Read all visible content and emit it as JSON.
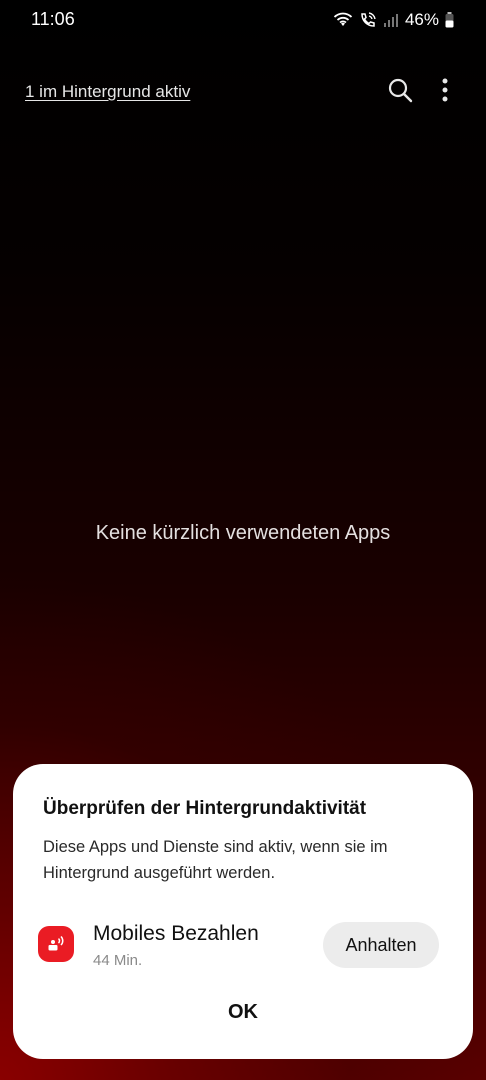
{
  "status_bar": {
    "time": "11:06",
    "battery_percent": "46%",
    "icons": [
      "wifi-icon",
      "wifi-call-icon",
      "signal-icon",
      "battery-icon"
    ]
  },
  "top": {
    "background_active_link": "1 im Hintergrund aktiv",
    "icons": [
      "search-icon",
      "more-options-icon"
    ]
  },
  "empty_state": {
    "text": "Keine kürzlich verwendeten Apps"
  },
  "dialog": {
    "title": "Überprüfen der Hintergrundaktivität",
    "description": "Diese Apps und Dienste sind aktiv, wenn sie im Hintergrund ausgeführt werden.",
    "apps": [
      {
        "name": "Mobiles Bezahlen",
        "time": "44 Min.",
        "icon": "sparkasse-pay-icon",
        "action_label": "Anhalten"
      }
    ],
    "ok_label": "OK"
  },
  "colors": {
    "accent_red": "#ea1c24",
    "dialog_bg": "#ffffff",
    "button_bg": "#ececec"
  }
}
